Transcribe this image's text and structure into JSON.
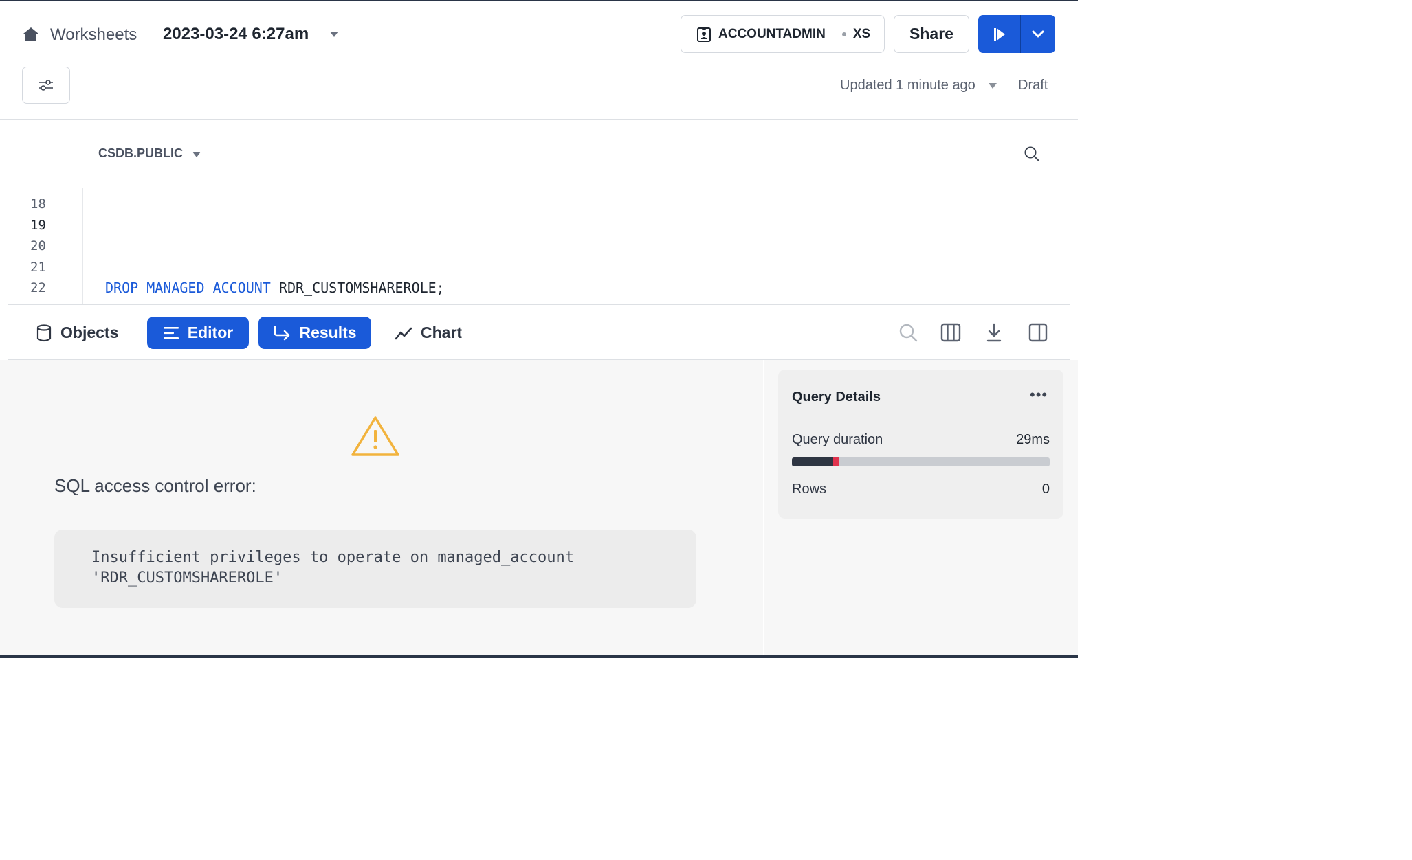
{
  "header": {
    "breadcrumb": "Worksheets",
    "worksheet_title": "2023-03-24 6:27am",
    "role": "ACCOUNTADMIN",
    "warehouse_size": "XS",
    "share_label": "Share",
    "updated_text": "Updated 1 minute ago",
    "status": "Draft"
  },
  "editor": {
    "context": "CSDB.PUBLIC",
    "line_numbers": [
      "18",
      "19",
      "20",
      "21",
      "22"
    ],
    "active_line": "19",
    "code": {
      "keyword1": "DROP",
      "keyword2": "MANAGED",
      "keyword3": "ACCOUNT",
      "identifier": "RDR_CUSTOMSHAREROLE;"
    }
  },
  "toolbar": {
    "objects": "Objects",
    "editor": "Editor",
    "results": "Results",
    "chart": "Chart"
  },
  "error": {
    "title": "SQL access control error:",
    "message": "Insufficient privileges to operate on managed_account\n'RDR_CUSTOMSHAREROLE'"
  },
  "query_details": {
    "title": "Query Details",
    "more": "•••",
    "duration_label": "Query duration",
    "duration_value": "29ms",
    "duration_progress": 0.18,
    "rows_label": "Rows",
    "rows_value": "0"
  },
  "colors": {
    "accent": "#1a5ad9",
    "warning": "#f2b33d",
    "error_mark": "#e0334d"
  }
}
